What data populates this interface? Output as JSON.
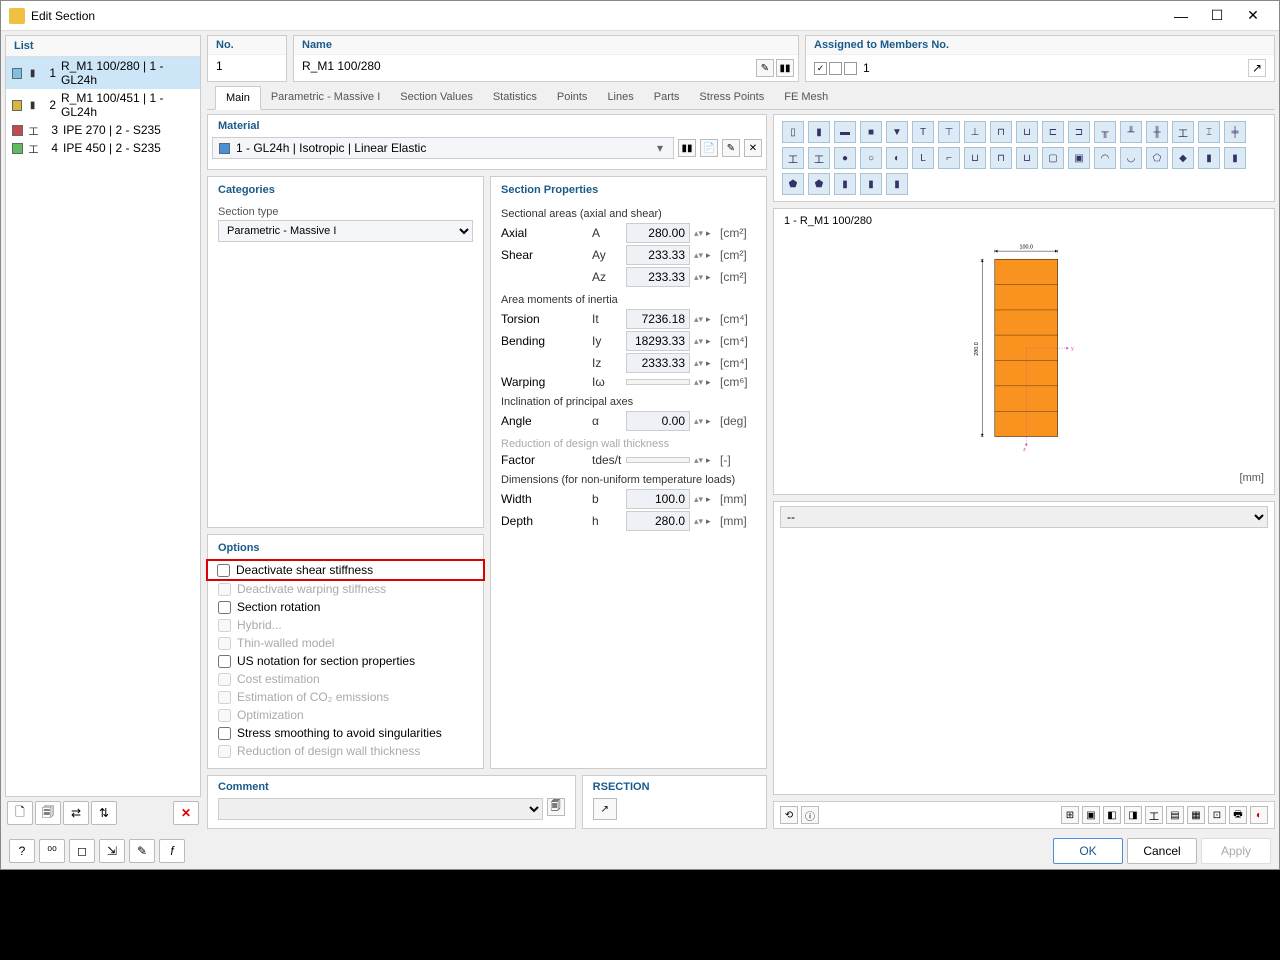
{
  "window": {
    "title": "Edit Section"
  },
  "list": {
    "header": "List",
    "items": [
      {
        "num": "1",
        "label": "R_M1 100/280 | 1 - GL24h",
        "color": "#79c2e6",
        "icon": "▮",
        "selected": true
      },
      {
        "num": "2",
        "label": "R_M1 100/451 | 1 - GL24h",
        "color": "#d9b63c",
        "icon": "▮",
        "selected": false
      },
      {
        "num": "3",
        "label": "IPE 270 | 2 - S235",
        "color": "#c24a4a",
        "icon": "工",
        "selected": false
      },
      {
        "num": "4",
        "label": "IPE 450 | 2 - S235",
        "color": "#5fbb5f",
        "icon": "工",
        "selected": false
      }
    ]
  },
  "top": {
    "no_label": "No.",
    "no_value": "1",
    "name_label": "Name",
    "name_value": "R_M1 100/280",
    "assign_label": "Assigned to Members No.",
    "assign_value": "1"
  },
  "tabs": [
    "Main",
    "Parametric - Massive I",
    "Section Values",
    "Statistics",
    "Points",
    "Lines",
    "Parts",
    "Stress Points",
    "FE Mesh"
  ],
  "material": {
    "header": "Material",
    "text": "1 - GL24h | Isotropic | Linear Elastic"
  },
  "categories": {
    "header": "Categories",
    "type_label": "Section type",
    "type_value": "Parametric - Massive I"
  },
  "options": {
    "header": "Options",
    "rows": [
      {
        "label": "Deactivate shear stiffness",
        "enabled": true,
        "highlight": true
      },
      {
        "label": "Deactivate warping stiffness",
        "enabled": false
      },
      {
        "label": "Section rotation",
        "enabled": true
      },
      {
        "label": "Hybrid...",
        "enabled": false
      },
      {
        "label": "Thin-walled model",
        "enabled": false
      },
      {
        "label": "US notation for section properties",
        "enabled": true
      },
      {
        "label": "Cost estimation",
        "enabled": false
      },
      {
        "label": "Estimation of CO₂ emissions",
        "enabled": false
      },
      {
        "label": "Optimization",
        "enabled": false
      },
      {
        "label": "Stress smoothing to avoid singularities",
        "enabled": true
      },
      {
        "label": "Reduction of design wall thickness",
        "enabled": false
      }
    ]
  },
  "props": {
    "header": "Section Properties",
    "groups": [
      {
        "title": "Sectional areas (axial and shear)",
        "rows": [
          {
            "label": "Axial",
            "sym": "A",
            "val": "280.00",
            "unit": "[cm²]"
          },
          {
            "label": "Shear",
            "sym": "Ay",
            "val": "233.33",
            "unit": "[cm²]"
          },
          {
            "label": "",
            "sym": "Az",
            "val": "233.33",
            "unit": "[cm²]"
          }
        ]
      },
      {
        "title": "Area moments of inertia",
        "rows": [
          {
            "label": "Torsion",
            "sym": "It",
            "val": "7236.18",
            "unit": "[cm⁴]"
          },
          {
            "label": "Bending",
            "sym": "Iy",
            "val": "18293.33",
            "unit": "[cm⁴]"
          },
          {
            "label": "",
            "sym": "Iz",
            "val": "2333.33",
            "unit": "[cm⁴]"
          },
          {
            "label": "Warping",
            "sym": "Iω",
            "val": "",
            "unit": "[cm⁶]",
            "disabled": true
          }
        ]
      },
      {
        "title": "Inclination of principal axes",
        "rows": [
          {
            "label": "Angle",
            "sym": "α",
            "val": "0.00",
            "unit": "[deg]"
          }
        ]
      },
      {
        "title": "Reduction of design wall thickness",
        "disabled": true,
        "rows": [
          {
            "label": "Factor",
            "sym": "tdes/t",
            "val": "",
            "unit": "[-]",
            "disabled": true
          }
        ]
      },
      {
        "title": "Dimensions (for non-uniform temperature loads)",
        "rows": [
          {
            "label": "Width",
            "sym": "b",
            "val": "100.0",
            "unit": "[mm]"
          },
          {
            "label": "Depth",
            "sym": "h",
            "val": "280.0",
            "unit": "[mm]"
          }
        ]
      }
    ]
  },
  "preview": {
    "title": "1 - R_M1 100/280",
    "unit": "[mm]",
    "dim_w": "100.0",
    "dim_h": "280.0"
  },
  "comment": {
    "header": "Comment"
  },
  "rsection": {
    "header": "RSECTION"
  },
  "status_dropdown": "--",
  "buttons": {
    "ok": "OK",
    "cancel": "Cancel",
    "apply": "Apply"
  }
}
